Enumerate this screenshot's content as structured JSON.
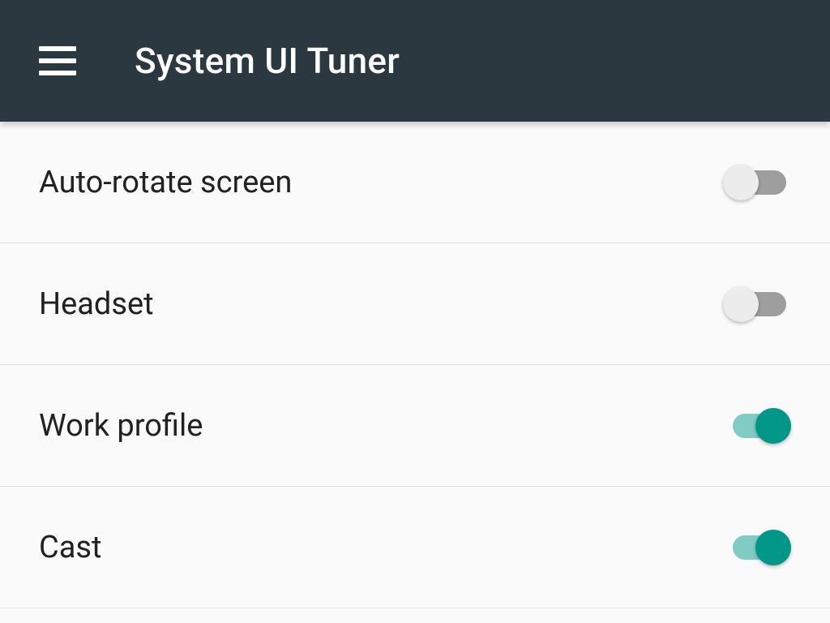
{
  "toolbar": {
    "title": "System UI Tuner"
  },
  "settings": [
    {
      "label": "Auto-rotate screen",
      "enabled": false
    },
    {
      "label": "Headset",
      "enabled": false
    },
    {
      "label": "Work profile",
      "enabled": true
    },
    {
      "label": "Cast",
      "enabled": true
    }
  ],
  "colors": {
    "toolbar_bg": "#2c383f",
    "accent": "#009688",
    "accent_light": "#80cbc4",
    "track_off": "#9e9e9e",
    "thumb_off": "#ececec"
  }
}
